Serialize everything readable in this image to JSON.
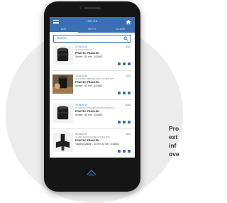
{
  "marketing_text": [
    "Pro",
    "ext",
    "inf",
    "ove"
  ],
  "app": {
    "header_title": "HRUTA",
    "tabs": [
      "LIST",
      "WHITE",
      "SCANS"
    ],
    "search_placeholder": "SEARCH",
    "accent_color": "#3b6fb3"
  },
  "items": [
    {
      "date": "10.06.2019",
      "sub": "ID: 8130000099 A-01",
      "name": "FRUITEC FRAULEN",
      "product": "Socket - 63 mm - 612663",
      "number": "0042",
      "thumb": "socket-black"
    },
    {
      "date": "10.06.2019",
      "sub": "ID: 12356847 4895 8956 4256 7412 8523 6578",
      "name": "FRUITEC FRAULEN",
      "product": "Socket - 63 mm - 612663",
      "number": "1234",
      "thumb": "socket-in-hand"
    },
    {
      "date": "09.06.2019",
      "sub": "ID: 4896 8523 4863 4857 8456 8523 8956 8123",
      "name": "FRUITEC FRAULEN",
      "product": "Socket - 63 mm - 612663",
      "number": "0036",
      "thumb": "socket-black"
    },
    {
      "date": "09.06.2019",
      "sub": "ID: 4863 4825 6529 6589 4123 5632 8963",
      "name": "FRUITEC FRAULEN",
      "product": "Tapping saddle - 63 mm 32 mm - 613852",
      "number": "1234",
      "thumb": "tapping-saddle"
    }
  ]
}
